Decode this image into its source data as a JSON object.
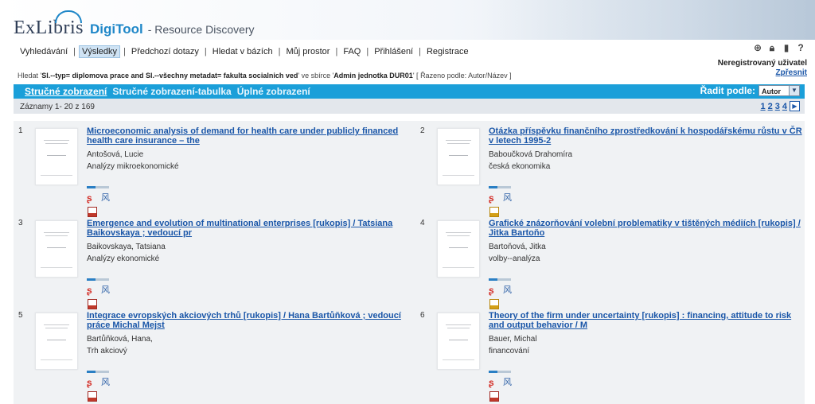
{
  "header": {
    "logo_exlibris": "ExLibris",
    "logo_digitool": "DigiTool",
    "logo_subtitle": "- Resource Discovery"
  },
  "nav": {
    "items": [
      "Vyhledávání",
      "Výsledky",
      "Předchozí dotazy",
      "Hledat v bázích",
      "Můj prostor",
      "FAQ",
      "Přihlášení",
      "Registrace"
    ],
    "active_index": 1,
    "separator": "|"
  },
  "user": {
    "label": "Neregistrovaný uživatel",
    "refine_link": "Zpřesnit"
  },
  "icons": {
    "globe": "globe-icon",
    "lock": "lock-icon",
    "door": "logout-icon",
    "help": "help-icon"
  },
  "query": {
    "prefix": "Hledat '",
    "query_text": "Sl.--typ= diplomova prace and Sl.--všechny metadat= fakulta socialnich ved",
    "middle": "' ve sbírce '",
    "collection": "Admin jednotka DUR01",
    "suffix": "' [",
    "sorted": "Řazeno podle: Autor/Název",
    "end": "]"
  },
  "views": {
    "brief": "Stručné zobrazení",
    "brief_table": "Stručné zobrazení-tabulka",
    "full": "Úplné zobrazení"
  },
  "sort": {
    "label": "Řadit podle:",
    "selected": "Autor"
  },
  "counts": {
    "label": "Záznamy 1- 20 z 169",
    "pages": [
      "1",
      "2",
      "3",
      "4"
    ]
  },
  "records": [
    {
      "num": "1",
      "title": "Microeconomic analysis of demand for health care under publicly financed health care insurance – the",
      "author": "Antošová, Lucie",
      "subject": "Analýzy mikroekonomické",
      "file": "pdf"
    },
    {
      "num": "2",
      "title": "Otázka příspěvku finančního zprostředkování k hospodářskému růstu v ČR v letech 1995-2",
      "author": "Baboučková Drahomíra",
      "subject": "česká ekonomika",
      "file": "package"
    },
    {
      "num": "3",
      "title": "Emergence and evolution of multinational enterprises [rukopis] / Tatsiana Baikovskaya ; vedoucí pr",
      "author": "Baikovskaya, Tatsiana",
      "subject": "Analýzy ekonomické",
      "file": "pdf"
    },
    {
      "num": "4",
      "title": "Grafické znázorňování volební problematiky v tištěných médiích [rukopis] / Jitka Bartoňo",
      "author": "Bartoňová, Jitka",
      "subject": "volby--analýza",
      "file": "package"
    },
    {
      "num": "5",
      "title": "Integrace evropských akciových trhů [rukopis] / Hana Bartůňková ; vedoucí práce Michal Mejst",
      "author": "Bartůňková, Hana,",
      "subject": "Trh akciový",
      "file": "pdf"
    },
    {
      "num": "6",
      "title": "Theory of the firm under uncertainty [rukopis] : financing, attitude to risk and output behavior / M",
      "author": "Bauer, Michal",
      "subject": "financování",
      "file": "pdf"
    }
  ],
  "record_icons": {
    "sfx": "ʂ",
    "cart": "⻛"
  }
}
